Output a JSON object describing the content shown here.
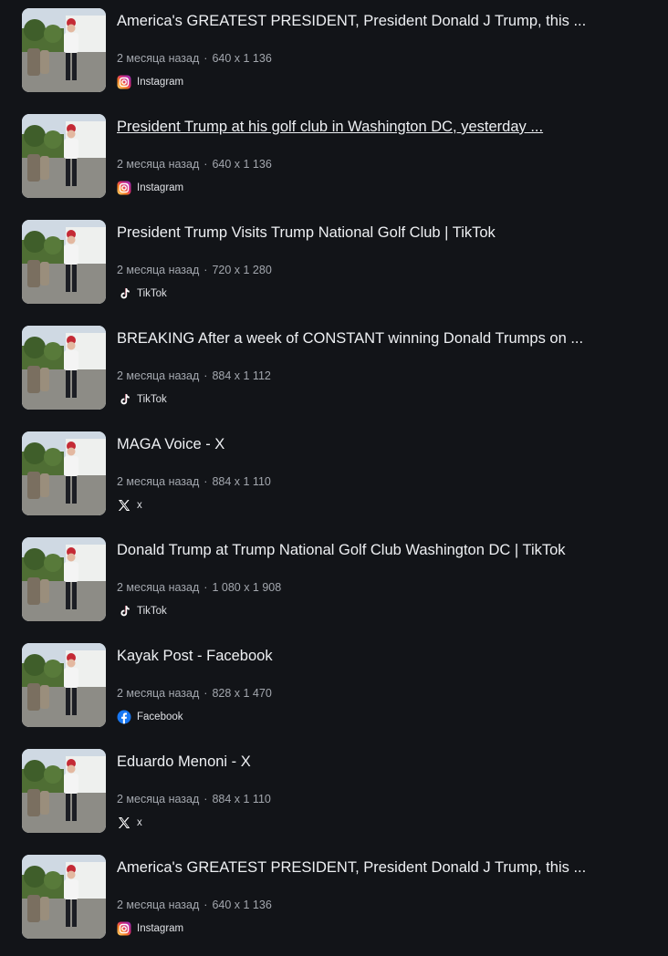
{
  "results": [
    {
      "title": "America's GREATEST PRESIDENT, President Donald J Trump, this ...",
      "age": "2 месяца назад",
      "dims": "640 x 1 136",
      "source": "Instagram",
      "icon": "instagram-icon",
      "underlined": false
    },
    {
      "title": "President Trump at his golf club in Washington DC, yesterday ...",
      "age": "2 месяца назад",
      "dims": "640 x 1 136",
      "source": "Instagram",
      "icon": "instagram-icon",
      "underlined": true
    },
    {
      "title": "President Trump Visits Trump National Golf Club | TikTok",
      "age": "2 месяца назад",
      "dims": "720 x 1 280",
      "source": "TikTok",
      "icon": "tiktok-icon",
      "underlined": false
    },
    {
      "title": "BREAKING After a week of CONSTANT winning Donald Trumps on ...",
      "age": "2 месяца назад",
      "dims": "884 x 1 112",
      "source": "TikTok",
      "icon": "tiktok-icon",
      "underlined": false
    },
    {
      "title": "MAGA Voice - X",
      "age": "2 месяца назад",
      "dims": "884 x 1 110",
      "source": "x",
      "icon": "x-icon",
      "underlined": false
    },
    {
      "title": "Donald Trump at Trump National Golf Club Washington DC | TikTok",
      "age": "2 месяца назад",
      "dims": "1 080 x 1 908",
      "source": "TikTok",
      "icon": "tiktok-icon",
      "underlined": false
    },
    {
      "title": "Kayak Post - Facebook",
      "age": "2 месяца назад",
      "dims": "828 x 1 470",
      "source": "Facebook",
      "icon": "facebook-icon",
      "underlined": false
    },
    {
      "title": "Eduardo Menoni - X",
      "age": "2 месяца назад",
      "dims": "884 x 1 110",
      "source": "x",
      "icon": "x-icon",
      "underlined": false
    },
    {
      "title": "America's GREATEST PRESIDENT, President Donald J Trump, this ...",
      "age": "2 месяца назад",
      "dims": "640 x 1 136",
      "source": "Instagram",
      "icon": "instagram-icon",
      "underlined": false
    }
  ],
  "separator": "·",
  "colors": {
    "background": "#121418",
    "meta": "#a3a7ae",
    "title": "#eef0f3"
  }
}
